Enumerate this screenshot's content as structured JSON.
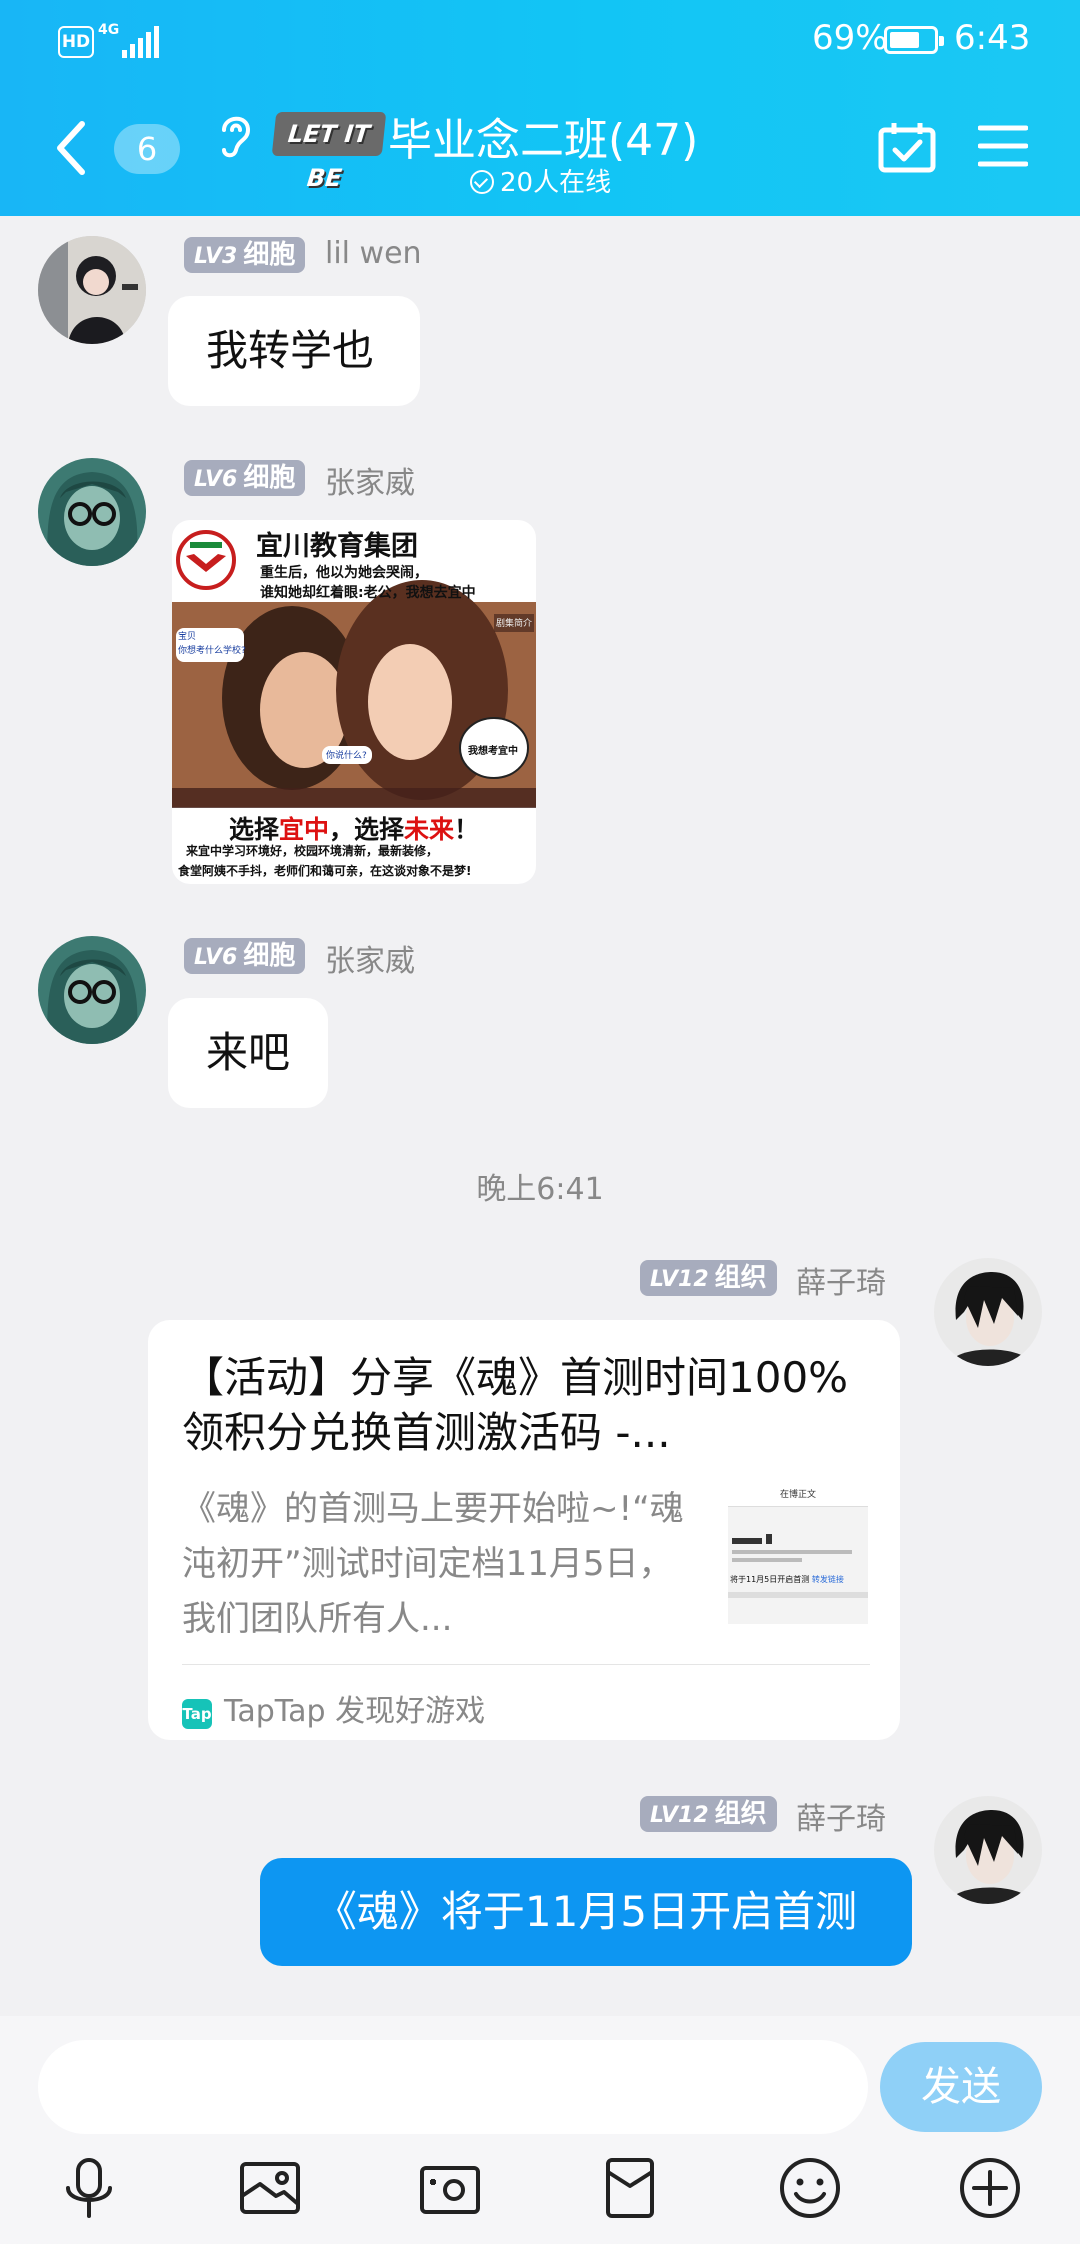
{
  "status_bar": {
    "hd": "HD",
    "network": "4G",
    "battery_percent_text": "69%",
    "battery_level": 0.69,
    "time": "6:43"
  },
  "header": {
    "unread_count": "6",
    "badge_text": "LET IT BE",
    "title": "毕业念二班(47)",
    "online_text": "20人在线"
  },
  "messages": [
    {
      "level": "LV3",
      "rank": "细胞",
      "name": "lil wen",
      "text": "我转学也"
    },
    {
      "level": "LV6",
      "rank": "细胞",
      "name": "张家威",
      "image": {
        "org": "宜川教育集团",
        "line1": "重生后，他以为她会哭闹，",
        "line2": "谁知她却红着眼:老公，我想去宜中",
        "tag": "剧集简介",
        "bubble_left": "宝贝\n你想考什么学校?",
        "bubble_small": "你说什么?",
        "bubble_right": "我想考宜中",
        "slogan_a": "选择",
        "slogan_b": "宜中",
        "slogan_c": "，选择",
        "slogan_d": "未来",
        "slogan_e": "！",
        "footer1": "来宜中学习环境好，校园环境清新，最新装修，",
        "footer2": "食堂阿姨不手抖，老师们和蔼可亲，在这谈对象不是梦!"
      }
    },
    {
      "level": "LV6",
      "rank": "细胞",
      "name": "张家威",
      "text": "来吧"
    }
  ],
  "timestamp": "晚上6:41",
  "card_message": {
    "level": "LV12",
    "rank": "组织",
    "name": "薛子琦",
    "title": "【活动】分享《魂》首测时间100%领积分兑换首测激活码 -...",
    "desc": "《魂》的首测马上要开始啦~!“魂沌初开”测试时间定档11月5日，我们团队所有人...",
    "thumb_header": "在博正文",
    "thumb_line": "将于11月5日开启首测",
    "thumb_link": "转发链接",
    "source_icon": "Tap",
    "source": "TapTap 发现好游戏"
  },
  "blue_message": {
    "level": "LV12",
    "rank": "组织",
    "name": "薛子琦",
    "text": "《魂》将于11月5日开启首测"
  },
  "input": {
    "placeholder": "",
    "send_label": "发送"
  },
  "toolbar": [
    "microphone-icon",
    "image-icon",
    "camera-icon",
    "red-packet-icon",
    "emoji-icon",
    "plus-icon"
  ],
  "colors": {
    "header": "#18b6f6",
    "accent": "#0d96f2",
    "send_disabled": "#8fd0f7",
    "level_badge": "#a7acbd"
  }
}
